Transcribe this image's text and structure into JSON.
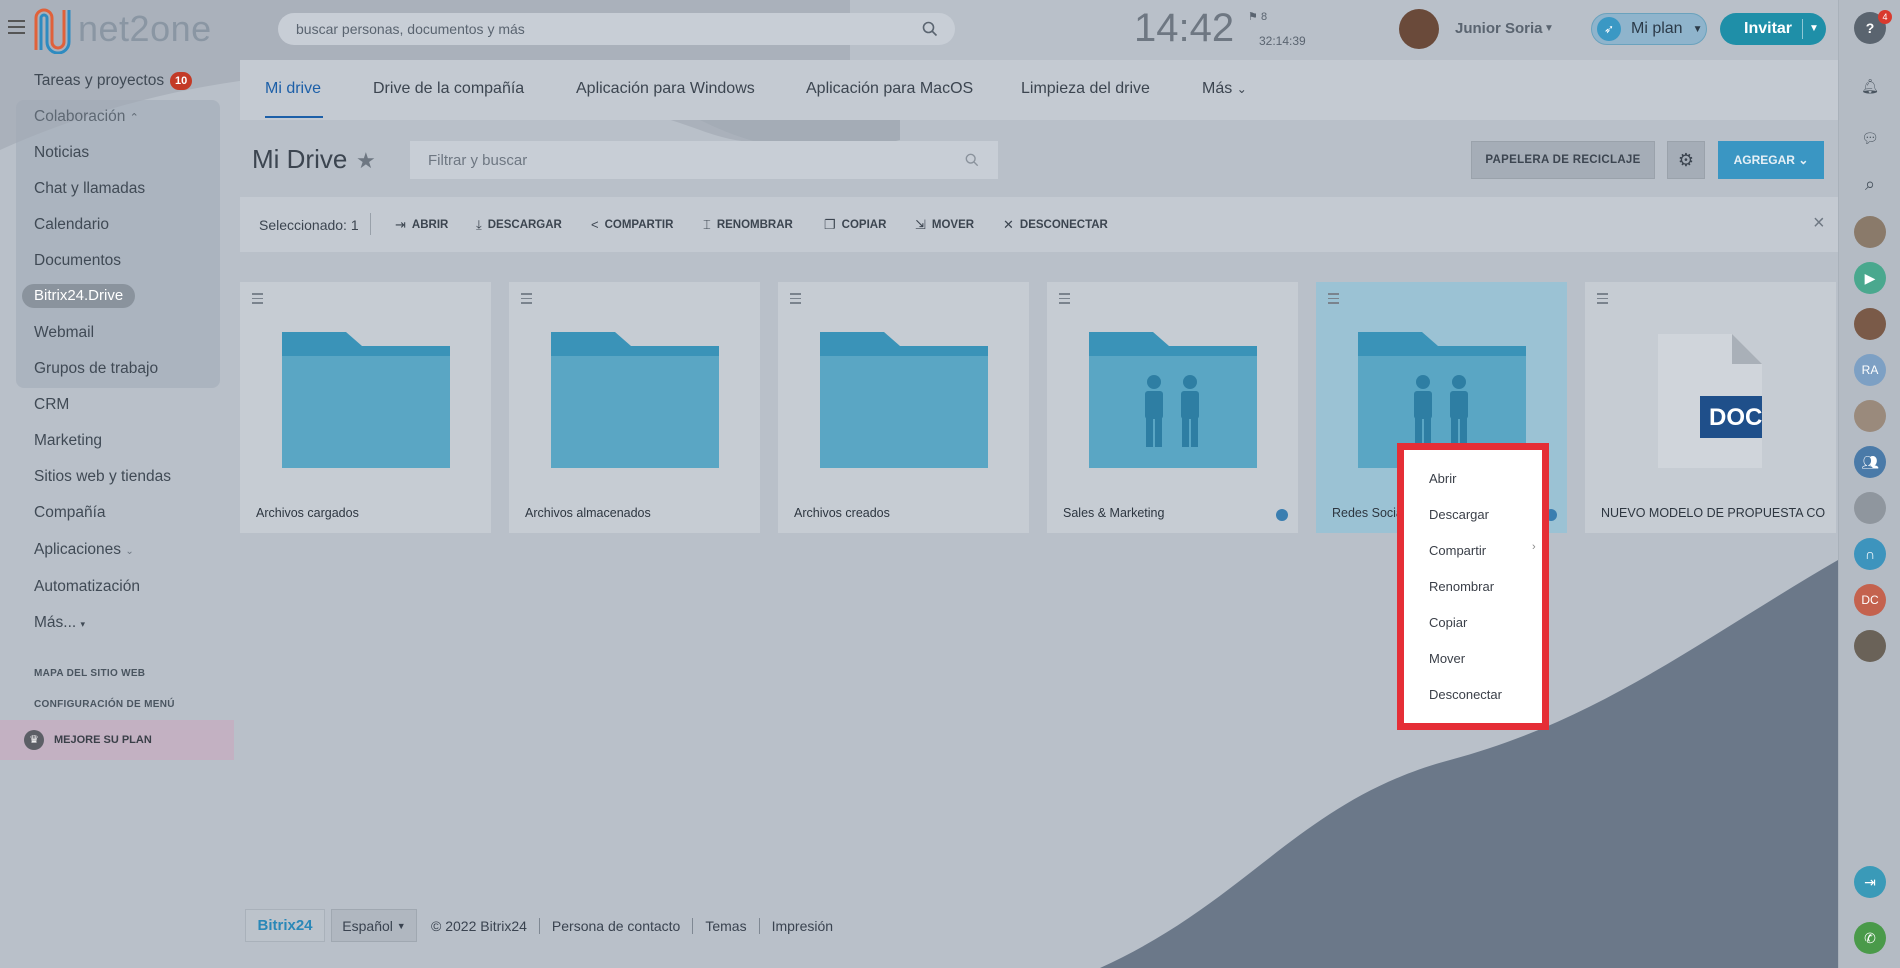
{
  "topbar": {
    "logo_text": "net2one",
    "search_placeholder": "buscar personas, documentos y más",
    "clock": "14:42",
    "flag_count": "8",
    "timer": "32:14:39",
    "user_name": "Junior Soria",
    "plan_label": "Mi plan",
    "invite_label": "Invitar"
  },
  "rail": {
    "help_badge": "4",
    "avatar_ra": "RA",
    "avatar_dc": "DC"
  },
  "sidebar": {
    "tasks_label": "Tareas y proyectos",
    "tasks_badge": "10",
    "collab_label": "Colaboración",
    "items": [
      "Noticias",
      "Chat y llamadas",
      "Calendario",
      "Documentos",
      "Bitrix24.Drive",
      "Webmail",
      "Grupos de trabajo"
    ],
    "crm": "CRM",
    "marketing": "Marketing",
    "sites": "Sitios web y tiendas",
    "company": "Compañía",
    "apps": "Aplicaciones",
    "automation": "Automatización",
    "more": "Más...",
    "sitemap": "MAPA DEL SITIO WEB",
    "menu_config": "CONFIGURACIÓN DE MENÚ",
    "upgrade": "MEJORE SU PLAN"
  },
  "tabs": [
    "Mi drive",
    "Drive de la compañía",
    "Aplicación para Windows",
    "Aplicación para MacOS",
    "Limpieza del drive",
    "Más"
  ],
  "page": {
    "title": "Mi Drive",
    "filter_placeholder": "Filtrar y buscar",
    "recycle_label": "PAPELERA DE RECICLAJE",
    "add_label": "AGREGAR"
  },
  "actionbar": {
    "selected": "Seleccionado: 1",
    "open": "ABRIR",
    "download": "DESCARGAR",
    "share": "COMPARTIR",
    "rename": "RENOMBRAR",
    "copy": "COPIAR",
    "move": "MOVER",
    "disconnect": "DESCONECTAR"
  },
  "tiles": [
    {
      "name": "Archivos cargados",
      "kind": "folder"
    },
    {
      "name": "Archivos almacenados",
      "kind": "folder"
    },
    {
      "name": "Archivos creados",
      "kind": "folder"
    },
    {
      "name": "Sales & Marketing",
      "kind": "shared-folder"
    },
    {
      "name": "Redes Socia",
      "kind": "shared-folder"
    },
    {
      "name": "NUEVO MODELO DE PROPUESTA CO...",
      "kind": "doc",
      "doc_label": "DOC"
    }
  ],
  "context_menu": [
    "Abrir",
    "Descargar",
    "Compartir",
    "Renombrar",
    "Copiar",
    "Mover",
    "Desconectar"
  ],
  "footer": {
    "logo": "Bitrix24",
    "language": "Español",
    "copyright": "© 2022 Bitrix24",
    "links": [
      "Persona de contacto",
      "Temas",
      "Impresión"
    ]
  },
  "colors": {
    "accent": "#1c5fa8",
    "folder": "#56a2c0",
    "menu_outline": "#e52e36",
    "invite": "#1f8fa8"
  }
}
